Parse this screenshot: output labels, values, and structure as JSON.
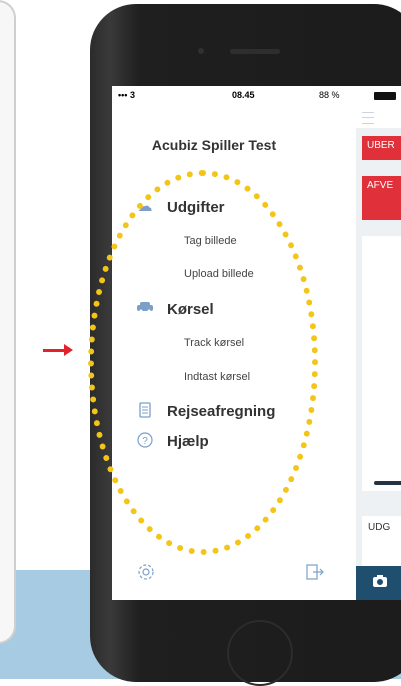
{
  "status_bar": {
    "signal": "••• 3",
    "time": "08.45",
    "battery_text": "88 %"
  },
  "drawer": {
    "app_title": "Acubiz Spiller Test",
    "sections": [
      {
        "label": "Udgifter",
        "icon": "receipt-icon",
        "subitems": [
          "Tag billede",
          "Upload billede"
        ]
      },
      {
        "label": "Kørsel",
        "icon": "car-icon",
        "subitems": [
          "Track kørsel",
          "Indtast kørsel"
        ]
      },
      {
        "label": "Rejseafregning",
        "icon": "document-icon",
        "subitems": []
      },
      {
        "label": "Hjælp",
        "icon": "help-icon",
        "subitems": []
      }
    ],
    "footer_icons": [
      "settings-icon",
      "logout-icon"
    ]
  },
  "content_peek": {
    "buttons": [
      "UBER",
      "AFVE"
    ],
    "card_text": "UDG"
  },
  "colors": {
    "accent": "#7b9fc7",
    "red": "#e0303a",
    "highlight": "#f3c519",
    "arrow": "#e0232c",
    "dark_blue": "#1f4e6f"
  }
}
